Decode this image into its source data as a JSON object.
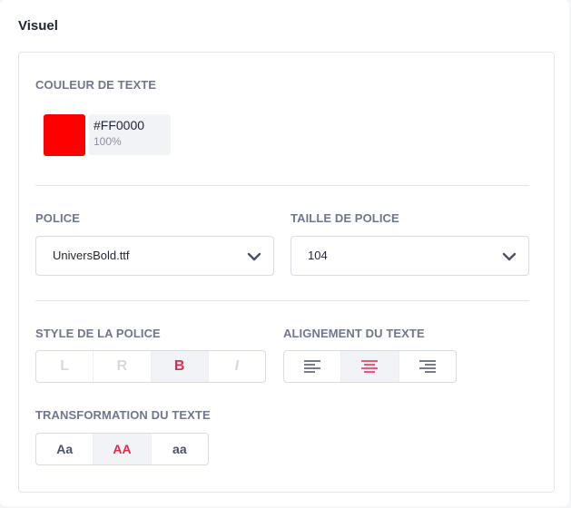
{
  "panel": {
    "title": "Visuel"
  },
  "text_color": {
    "label": "COULEUR DE TEXTE",
    "hex": "#FF0000",
    "opacity": "100%",
    "swatch_color": "#FF0000"
  },
  "font": {
    "label": "POLICE",
    "value": "UniversBold.ttf"
  },
  "font_size": {
    "label": "TAILLE DE POLICE",
    "value": "104"
  },
  "font_style": {
    "label": "STYLE DE LA POLICE",
    "options": [
      {
        "text": "L",
        "active": false
      },
      {
        "text": "R",
        "active": false
      },
      {
        "text": "B",
        "active": true
      },
      {
        "text": "I",
        "active": false
      }
    ]
  },
  "alignment": {
    "label": "ALIGNEMENT DU TEXTE",
    "options": [
      {
        "icon": "align-left-icon",
        "active": false
      },
      {
        "icon": "align-center-icon",
        "active": true
      },
      {
        "icon": "align-right-icon",
        "active": false
      }
    ]
  },
  "transform": {
    "label": "TRANSFORMATION DU TEXTE",
    "options": [
      {
        "text": "Aa",
        "active": false
      },
      {
        "text": "AA",
        "active": true
      },
      {
        "text": "aa",
        "active": false
      }
    ]
  },
  "colors": {
    "accent": "#E6294A",
    "label": "#6F7690",
    "border": "#D9DCE3"
  }
}
